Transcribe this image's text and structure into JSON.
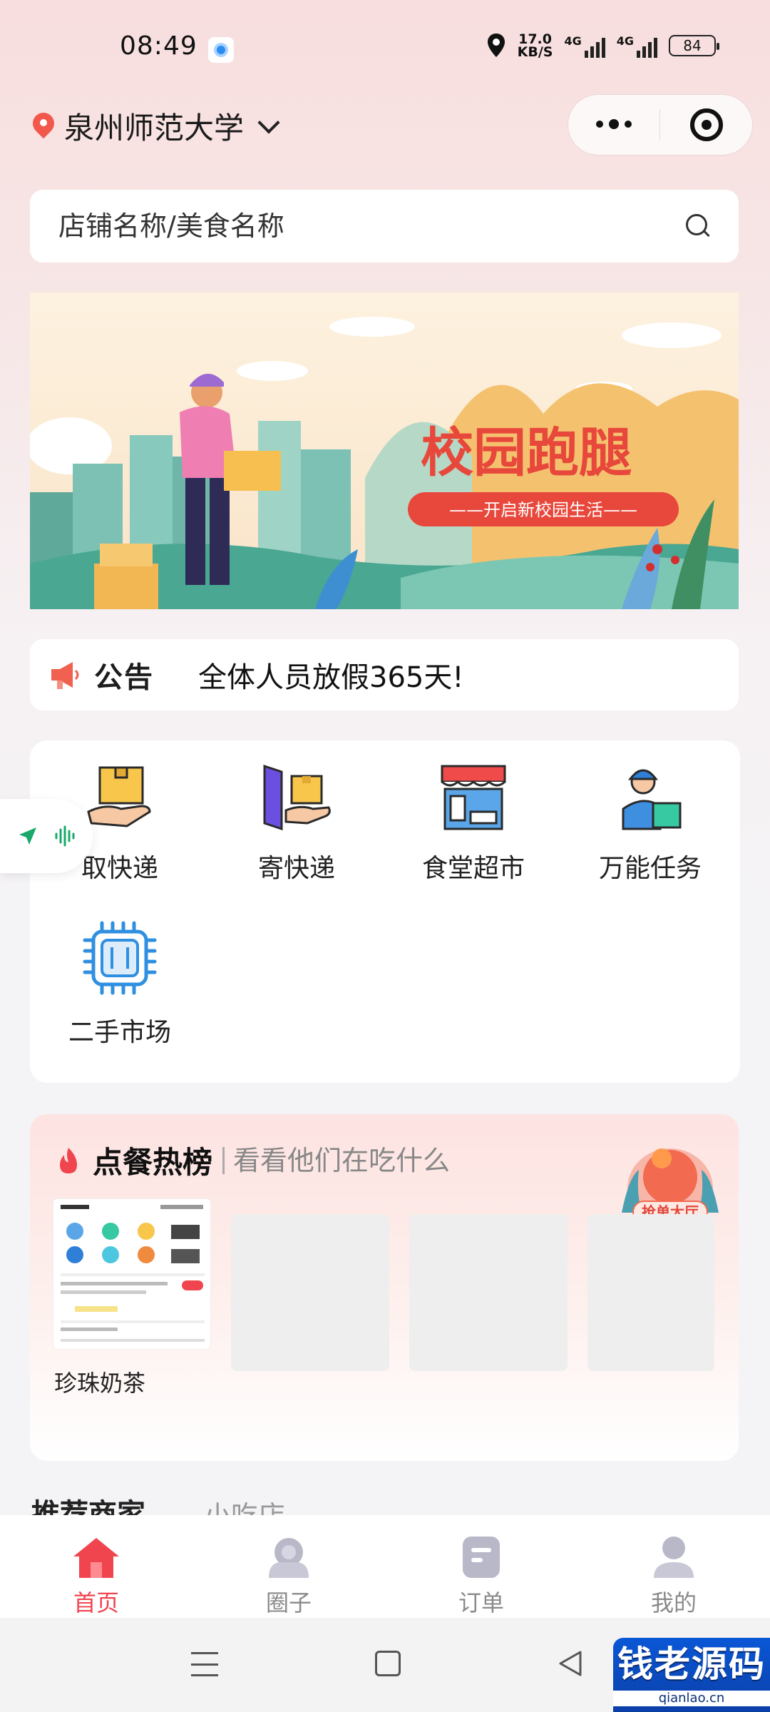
{
  "status_bar": {
    "time": "08:49",
    "net_speed_value": "17.0",
    "net_speed_unit": "KB/S",
    "sim1": "4G",
    "sim2": "4G",
    "battery": "84"
  },
  "header": {
    "location": "泉州师范大学",
    "search_placeholder": "店铺名称/美食名称"
  },
  "banner": {
    "title": "校园跑腿",
    "subtitle": "——开启新校园生活——"
  },
  "notice": {
    "label": "公告",
    "text": "全体人员放假365天!"
  },
  "services": [
    {
      "label": "取快递",
      "icon": "package-pickup-icon"
    },
    {
      "label": "寄快递",
      "icon": "package-send-icon"
    },
    {
      "label": "食堂超市",
      "icon": "store-icon"
    },
    {
      "label": "万能任务",
      "icon": "courier-icon"
    },
    {
      "label": "二手市场",
      "icon": "chip-market-icon"
    }
  ],
  "hot_list": {
    "title": "点餐热榜",
    "subtitle": "看看他们在吃什么",
    "badge": "抢单大厅",
    "items": [
      {
        "name": "珍珠奶茶"
      }
    ]
  },
  "recommend": {
    "title": "推荐商家",
    "tab": "小吃店"
  },
  "tabbar": [
    {
      "label": "首页",
      "active": true,
      "icon": "home-icon"
    },
    {
      "label": "圈子",
      "active": false,
      "icon": "circle-icon"
    },
    {
      "label": "订单",
      "active": false,
      "icon": "order-icon"
    },
    {
      "label": "我的",
      "active": false,
      "icon": "profile-icon"
    }
  ],
  "watermark": {
    "main": "钱老源码",
    "sub": "qianlao.cn"
  },
  "colors": {
    "accent": "#f0454f",
    "tab_inactive": "#b8b8c8"
  }
}
